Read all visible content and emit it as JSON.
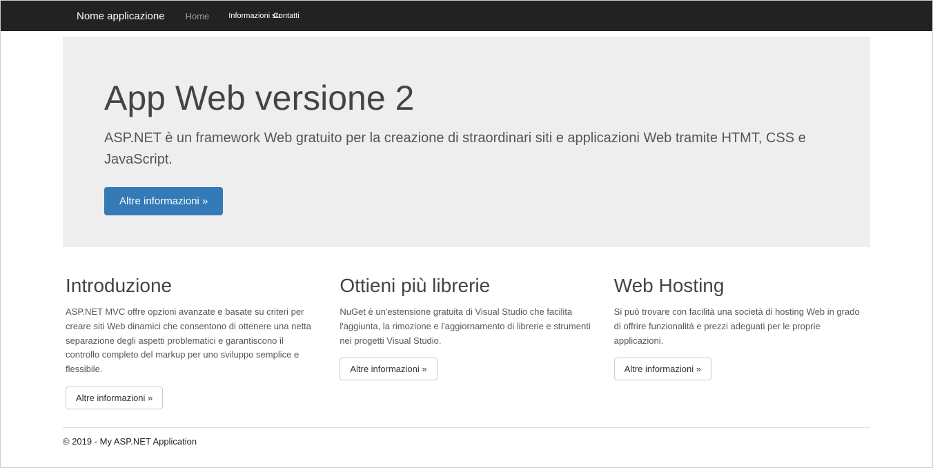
{
  "navbar": {
    "brand": "Nome applicazione",
    "links": {
      "home": "Home",
      "info": "Informazioni su",
      "contact": "Contatti"
    }
  },
  "jumbotron": {
    "title": "App Web versione 2",
    "lead": "ASP.NET è un framework Web gratuito per la creazione di straordinari siti e applicazioni Web tramite HTMT, CSS e JavaScript.",
    "button": "Altre informazioni »"
  },
  "columns": [
    {
      "title": "Introduzione",
      "body": "ASP.NET MVC offre opzioni avanzate e basate su criteri per creare siti Web dinamici che consentono di ottenere una netta separazione degli aspetti problematici e garantiscono il controllo completo del markup per uno sviluppo semplice e flessibile.",
      "button": "Altre informazioni »"
    },
    {
      "title": "Ottieni più librerie",
      "body": "NuGet è un'estensione gratuita di Visual Studio che facilita l'aggiunta, la rimozione e l'aggiornamento di librerie e strumenti nei progetti Visual Studio.",
      "button": "Altre informazioni »"
    },
    {
      "title": "Web Hosting",
      "body": "Si può trovare con facilità una società di hosting Web in grado di offrire funzionalità e prezzi adeguati per le proprie applicazioni.",
      "button": "Altre informazioni »"
    }
  ],
  "footer": {
    "text": "© 2019 - My ASP.NET Application"
  }
}
